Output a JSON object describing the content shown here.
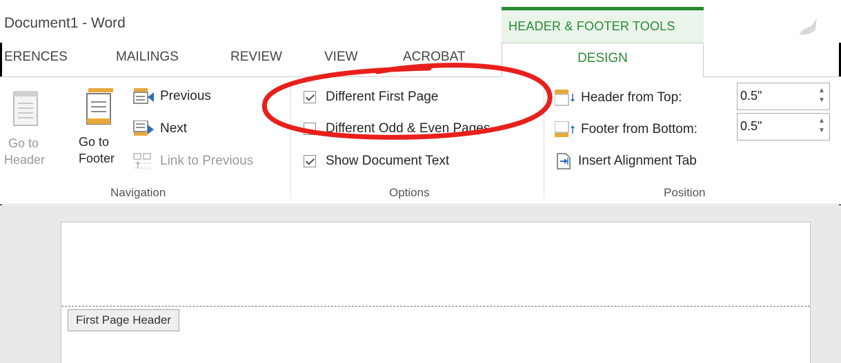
{
  "titlebar": {
    "doc_title": "Document1 - Word",
    "contextual_group": "HEADER & FOOTER TOOLS"
  },
  "tabs": {
    "references": "ERENCES",
    "mailings": "MAILINGS",
    "review": "REVIEW",
    "view": "VIEW",
    "acrobat": "ACROBAT",
    "design": "DESIGN"
  },
  "navigation": {
    "group_label": "Navigation",
    "go_to_header": [
      "Go to",
      "Header"
    ],
    "go_to_footer": [
      "Go to",
      "Footer"
    ],
    "previous": "Previous",
    "next": "Next",
    "link_to_previous": "Link to Previous"
  },
  "options": {
    "group_label": "Options",
    "different_first_page": "Different First Page",
    "different_first_page_checked": true,
    "different_odd_even": "Different Odd & Even Pages",
    "different_odd_even_checked": false,
    "show_document_text": "Show Document Text",
    "show_document_text_checked": true
  },
  "position": {
    "group_label": "Position",
    "header_from_top_label": "Header from Top:",
    "header_from_top_value": "0.5\"",
    "footer_from_bottom_label": "Footer from Bottom:",
    "footer_from_bottom_value": "0.5\"",
    "insert_alignment_tab": "Insert Alignment Tab"
  },
  "document": {
    "header_tag": "First Page Header"
  },
  "colors": {
    "accent_green": "#2a8a34",
    "annotation_red": "#e8201c"
  },
  "icons": [
    "go-to-header-icon",
    "go-to-footer-icon",
    "previous-icon",
    "next-icon",
    "link-to-previous-icon",
    "header-from-top-icon",
    "footer-from-bottom-icon",
    "insert-alignment-tab-icon",
    "office-logo-icon"
  ]
}
